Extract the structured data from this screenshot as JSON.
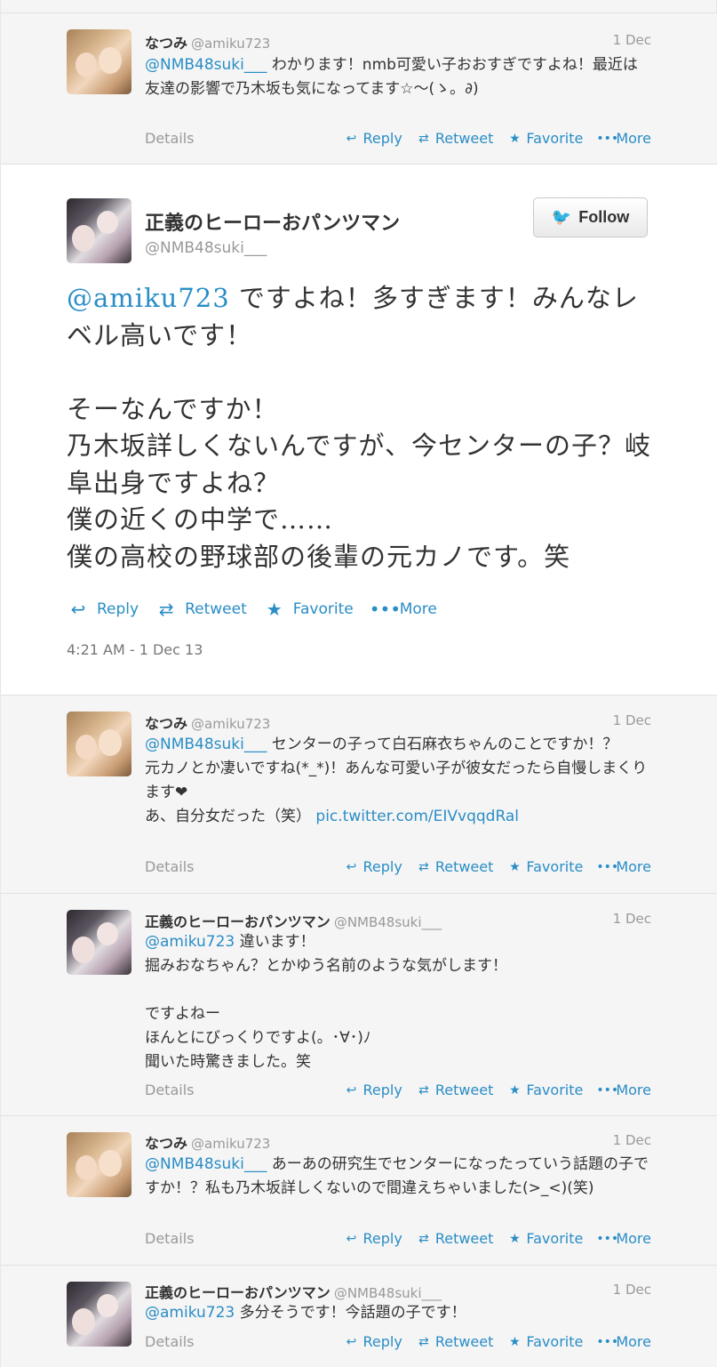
{
  "tweets_before": [
    {
      "name": "なつみ",
      "handle": "@amiku723",
      "date": "1 Dec",
      "mention": "@NMB48suki___",
      "text": " わかります！nmb可愛い子おおすぎですよね！最近は友達の影響で乃木坂も気になってます☆〜(ゝ。∂)"
    }
  ],
  "main_tweet": {
    "name": "正義のヒーローおパンツマン",
    "handle": "@NMB48suki___",
    "follow_label": "Follow",
    "mention": "@amiku723",
    "text": " ですよね！多すぎます！みんなレベル高いです！\n\nそーなんですか！\n乃木坂詳しくないんですが、今センターの子？岐阜出身ですよね？\n僕の近くの中学で……\n僕の高校の野球部の後輩の元カノです。笑",
    "timestamp": "4:21 AM - 1 Dec 13"
  },
  "replies": [
    {
      "name": "なつみ",
      "handle": "@amiku723",
      "date": "1 Dec",
      "mention": "@NMB48suki___",
      "text": " センターの子って白石麻衣ちゃんのことですか！？\n元カノとか凄いですね(*_*)！あんな可愛い子が彼女だったら自慢しまくります❤\nあ、自分女だった（笑） ",
      "link": "pic.twitter.com/EIVvqqdRal"
    },
    {
      "name": "正義のヒーローおパンツマン",
      "handle": "@NMB48suki___",
      "date": "1 Dec",
      "mention": "@amiku723",
      "text": " 違います！\n掘みおなちゃん？とかゆう名前のような気がします！\n\nですよねー\nほんとにびっくりですよ(。･∀･)ﾉ\n聞いた時驚きました。笑"
    },
    {
      "name": "なつみ",
      "handle": "@amiku723",
      "date": "1 Dec",
      "mention": "@NMB48suki___",
      "text": " あーあの研究生でセンターになったっていう話題の子ですか！？私も乃木坂詳しくないので間違えちゃいました(>_<)(笑)"
    },
    {
      "name": "正義のヒーローおパンツマン",
      "handle": "@NMB48suki___",
      "date": "1 Dec",
      "mention": "@amiku723",
      "text": " 多分そうです！今話題の子です！"
    }
  ],
  "actions": {
    "details": "Details",
    "reply": "Reply",
    "retweet": "Retweet",
    "favorite": "Favorite",
    "more": "More"
  },
  "icons": {
    "reply": "reply-arrow-icon",
    "retweet": "retweet-icon",
    "favorite": "star-icon",
    "more": "ellipsis-icon",
    "follow": "twitter-bird-icon"
  },
  "colors": {
    "link": "#2a8dc6",
    "muted": "#999999",
    "background": "#f5f5f5"
  }
}
